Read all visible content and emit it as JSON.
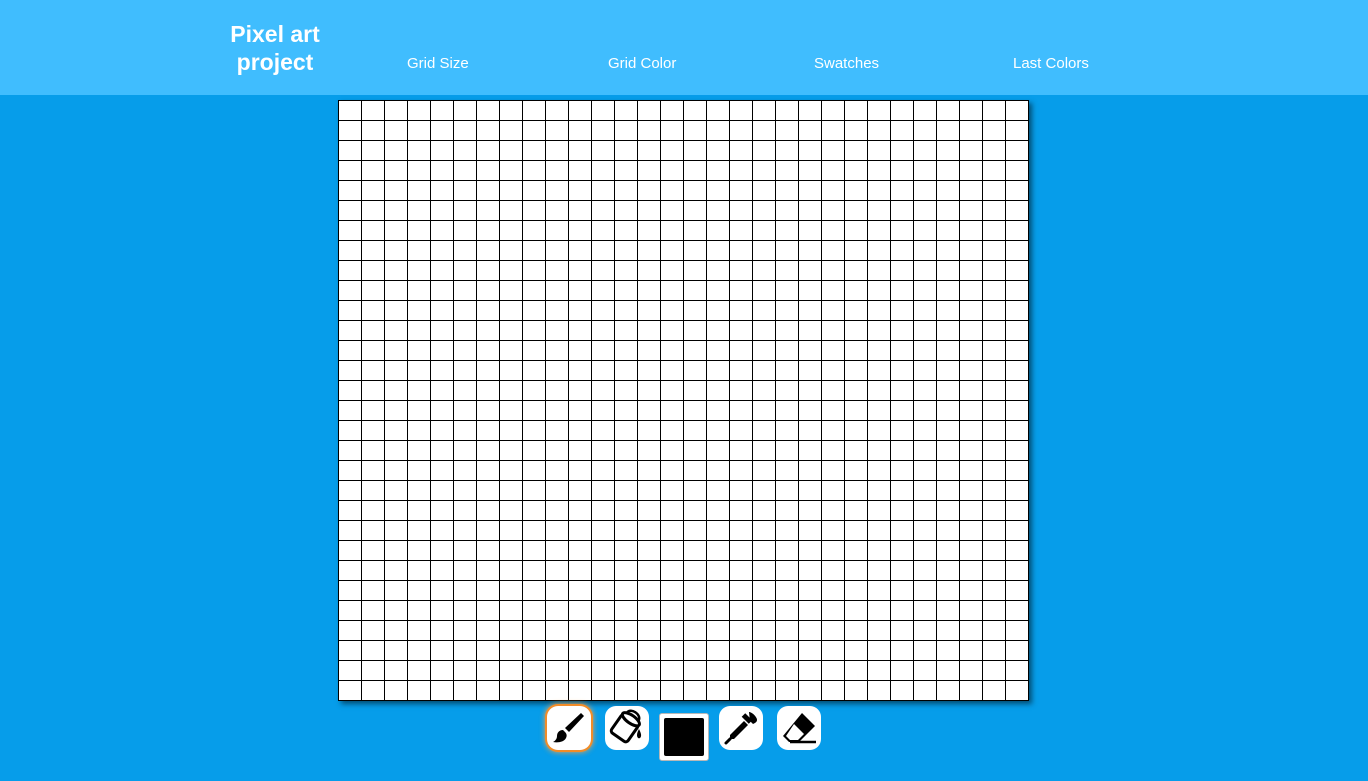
{
  "header": {
    "title": "Pixel art project",
    "nav": [
      {
        "label": "Grid Size"
      },
      {
        "label": "Grid Color"
      },
      {
        "label": "Swatches"
      },
      {
        "label": "Last Colors"
      }
    ]
  },
  "canvas": {
    "columns": 30,
    "rows": 30,
    "cell_color": "#ffffff",
    "line_color": "#000000"
  },
  "toolbar": {
    "tools": [
      {
        "name": "brush",
        "icon": "paintbrush-icon",
        "active": true
      },
      {
        "name": "fill",
        "icon": "paint-bucket-icon",
        "active": false
      },
      {
        "name": "picker",
        "icon": "eyedropper-icon",
        "active": false
      },
      {
        "name": "eraser",
        "icon": "eraser-icon",
        "active": false
      }
    ],
    "current_color": "#000000",
    "active_highlight_color": "#f28c28"
  },
  "colors": {
    "header_bg": "#40bdfe",
    "page_bg": "#069dea"
  }
}
